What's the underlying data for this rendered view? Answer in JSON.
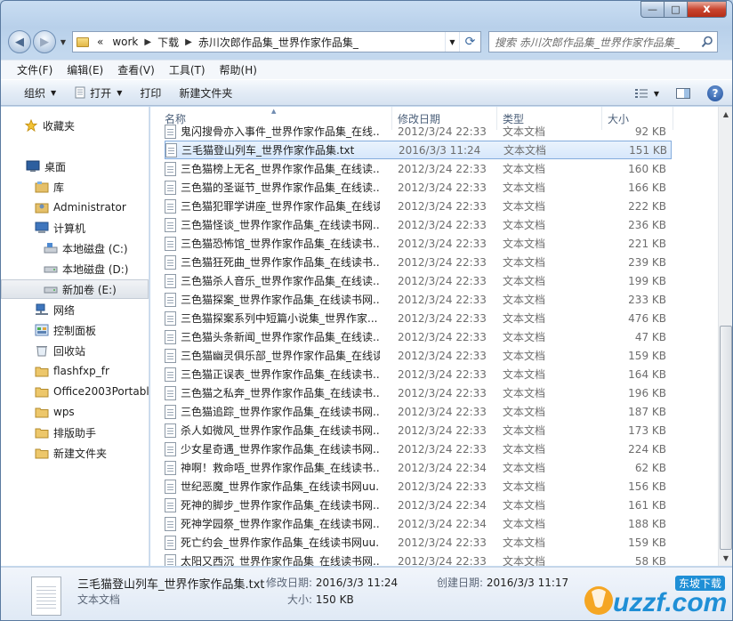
{
  "window": {
    "caption": {
      "minimize": "—",
      "maximize": "□",
      "close": "x"
    }
  },
  "nav": {
    "back": "◀",
    "forward": "▶",
    "breadcrumb": [
      "«",
      "work",
      "下载",
      "赤川次郎作品集_世界作家作品集_"
    ],
    "search_placeholder": "搜索 赤川次郎作品集_世界作家作品集_"
  },
  "menubar": {
    "items": [
      "文件(F)",
      "编辑(E)",
      "查看(V)",
      "工具(T)",
      "帮助(H)"
    ]
  },
  "commandbar": {
    "organize": "组织",
    "open": "打开",
    "print": "打印",
    "new_folder": "新建文件夹",
    "help": "?"
  },
  "sidebar": {
    "items": [
      {
        "label": "收藏夹",
        "icon": "star-icon"
      },
      {
        "label": "桌面",
        "icon": "desktop-icon"
      },
      {
        "label": "库",
        "icon": "library-icon"
      },
      {
        "label": "Administrator",
        "icon": "user-folder-icon"
      },
      {
        "label": "计算机",
        "icon": "computer-icon"
      },
      {
        "label": "本地磁盘 (C:)",
        "icon": "drive-icon"
      },
      {
        "label": "本地磁盘 (D:)",
        "icon": "drive-icon"
      },
      {
        "label": "新加卷 (E:)",
        "icon": "drive-icon"
      },
      {
        "label": "网络",
        "icon": "network-icon"
      },
      {
        "label": "控制面板",
        "icon": "control-panel-icon"
      },
      {
        "label": "回收站",
        "icon": "recycle-bin-icon"
      },
      {
        "label": "flashfxp_fr",
        "icon": "folder-icon"
      },
      {
        "label": "Office2003Portable",
        "icon": "folder-icon"
      },
      {
        "label": "wps",
        "icon": "folder-icon"
      },
      {
        "label": "排版助手",
        "icon": "folder-icon"
      },
      {
        "label": "新建文件夹",
        "icon": "folder-icon"
      }
    ]
  },
  "columns": {
    "name": "名称",
    "date": "修改日期",
    "type": "类型",
    "size": "大小"
  },
  "files": [
    {
      "name": "鬼闪搜骨亦入事件_世界作家作品集_在线...",
      "date": "2012/3/24 22:33",
      "type": "文本文档",
      "size": "92 KB"
    },
    {
      "name": "三毛猫登山列车_世界作家作品集.txt",
      "date": "2016/3/3 11:24",
      "type": "文本文档",
      "size": "151 KB"
    },
    {
      "name": "三色猫榜上无名_世界作家作品集_在线读...",
      "date": "2012/3/24 22:33",
      "type": "文本文档",
      "size": "160 KB"
    },
    {
      "name": "三色猫的圣诞节_世界作家作品集_在线读...",
      "date": "2012/3/24 22:33",
      "type": "文本文档",
      "size": "166 KB"
    },
    {
      "name": "三色猫犯罪学讲座_世界作家作品集_在线读...",
      "date": "2012/3/24 22:33",
      "type": "文本文档",
      "size": "222 KB"
    },
    {
      "name": "三色猫怪谈_世界作家作品集_在线读书网...",
      "date": "2012/3/24 22:33",
      "type": "文本文档",
      "size": "236 KB"
    },
    {
      "name": "三色猫恐怖馆_世界作家作品集_在线读书...",
      "date": "2012/3/24 22:33",
      "type": "文本文档",
      "size": "221 KB"
    },
    {
      "name": "三色猫狂死曲_世界作家作品集_在线读书...",
      "date": "2012/3/24 22:33",
      "type": "文本文档",
      "size": "239 KB"
    },
    {
      "name": "三色猫杀人音乐_世界作家作品集_在线读...",
      "date": "2012/3/24 22:33",
      "type": "文本文档",
      "size": "199 KB"
    },
    {
      "name": "三色猫探案_世界作家作品集_在线读书网...",
      "date": "2012/3/24 22:33",
      "type": "文本文档",
      "size": "233 KB"
    },
    {
      "name": "三色猫探案系列中短篇小说集_世界作家...",
      "date": "2012/3/24 22:33",
      "type": "文本文档",
      "size": "476 KB"
    },
    {
      "name": "三色猫头条新闻_世界作家作品集_在线读...",
      "date": "2012/3/24 22:33",
      "type": "文本文档",
      "size": "47 KB"
    },
    {
      "name": "三色猫幽灵俱乐部_世界作家作品集_在线读...",
      "date": "2012/3/24 22:33",
      "type": "文本文档",
      "size": "159 KB"
    },
    {
      "name": "三色猫正误表_世界作家作品集_在线读书...",
      "date": "2012/3/24 22:33",
      "type": "文本文档",
      "size": "164 KB"
    },
    {
      "name": "三色猫之私奔_世界作家作品集_在线读书...",
      "date": "2012/3/24 22:33",
      "type": "文本文档",
      "size": "196 KB"
    },
    {
      "name": "三色猫追踪_世界作家作品集_在线读书网...",
      "date": "2012/3/24 22:33",
      "type": "文本文档",
      "size": "187 KB"
    },
    {
      "name": "杀人如微风_世界作家作品集_在线读书网...",
      "date": "2012/3/24 22:33",
      "type": "文本文档",
      "size": "173 KB"
    },
    {
      "name": "少女星奇遇_世界作家作品集_在线读书网...",
      "date": "2012/3/24 22:33",
      "type": "文本文档",
      "size": "224 KB"
    },
    {
      "name": "神啊！救命唔_世界作家作品集_在线读书...",
      "date": "2012/3/24 22:34",
      "type": "文本文档",
      "size": "62 KB"
    },
    {
      "name": "世纪恶魔_世界作家作品集_在线读书网uu...",
      "date": "2012/3/24 22:33",
      "type": "文本文档",
      "size": "156 KB"
    },
    {
      "name": "死神的脚步_世界作家作品集_在线读书网...",
      "date": "2012/3/24 22:34",
      "type": "文本文档",
      "size": "161 KB"
    },
    {
      "name": "死神学园祭_世界作家作品集_在线读书网...",
      "date": "2012/3/24 22:34",
      "type": "文本文档",
      "size": "188 KB"
    },
    {
      "name": "死亡约会_世界作家作品集_在线读书网uu...",
      "date": "2012/3/24 22:33",
      "type": "文本文档",
      "size": "159 KB"
    },
    {
      "name": "太阳又西沉_世界作家作品集_在线读书网...",
      "date": "2012/3/24 22:33",
      "type": "文本文档",
      "size": "58 KB"
    }
  ],
  "details": {
    "name": "三毛猫登山列车_世界作家作品集.txt",
    "type": "文本文档",
    "modified_label": "修改日期:",
    "modified_value": "2016/3/3 11:24",
    "size_label": "大小:",
    "size_value": "150 KB",
    "created_label": "创建日期:",
    "created_value": "2016/3/3 11:17"
  },
  "watermark": {
    "brand": "uzzf.com",
    "tag": "东坡下载"
  }
}
